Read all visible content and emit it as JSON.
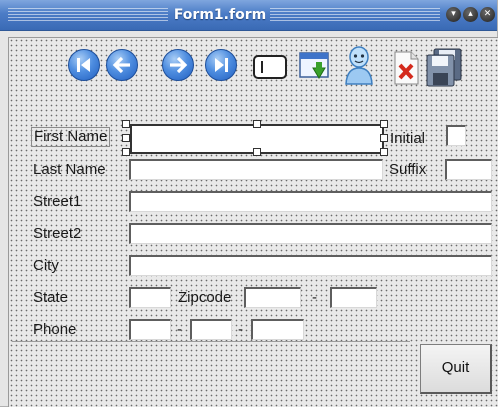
{
  "window": {
    "title": "Form1.form"
  },
  "toolbar": {
    "icons": [
      "first-record-icon",
      "previous-record-icon",
      "next-record-icon",
      "last-record-icon",
      "text-box-icon",
      "download-window-icon",
      "user-icon",
      "delete-icon",
      "save-disk-icon"
    ]
  },
  "fields": {
    "first_name_label": "First Name",
    "initial_label": "Initial",
    "last_name_label": "Last Name",
    "suffix_label": "Suffix",
    "street1_label": "Street1",
    "street2_label": "Street2",
    "city_label": "City",
    "state_label": "State",
    "zipcode_label": "Zipcode",
    "zip_separator": "-",
    "phone_label": "Phone",
    "phone_separator_1": "-",
    "phone_separator_2": "-"
  },
  "buttons": {
    "quit_label": "Quit"
  },
  "colors": {
    "titlebar": "#4b7cc6",
    "accent_blue": "#215fc0",
    "background": "#e6e6e6"
  }
}
